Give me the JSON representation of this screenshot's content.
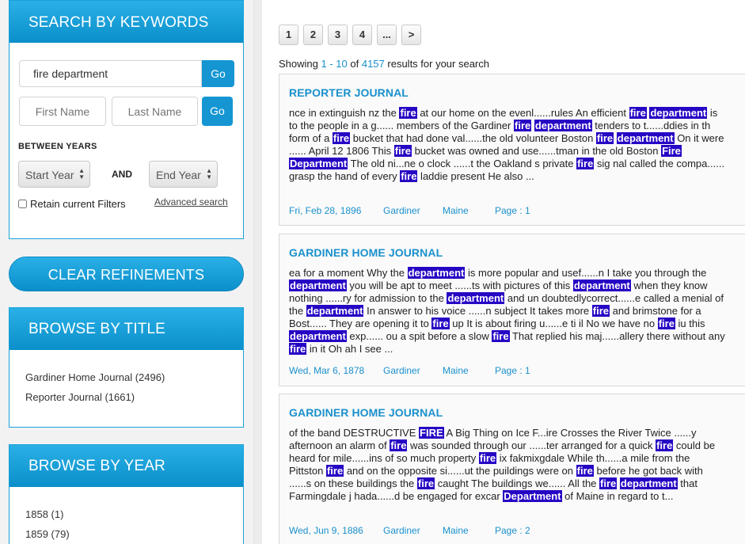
{
  "search_panel": {
    "title": "SEARCH BY KEYWORDS",
    "keyword_value": "fire department",
    "go_label": "Go",
    "first_name_placeholder": "First Name",
    "last_name_placeholder": "Last Name",
    "between_years_label": "BETWEEN YEARS",
    "start_year_label": "Start Year",
    "and_label": "AND",
    "end_year_label": "End Year",
    "retain_filters_label": "Retain current Filters",
    "advanced_search_label": "Advanced search"
  },
  "clear_refinements_label": "CLEAR REFINEMENTS",
  "browse_title": {
    "title": "BROWSE BY TITLE",
    "items": [
      "Gardiner Home Journal (2496)",
      "Reporter Journal (1661)"
    ]
  },
  "browse_year": {
    "title": "BROWSE BY YEAR",
    "items": [
      "1858 (1)",
      "1859 (79)"
    ]
  },
  "pager": {
    "pages": [
      "1",
      "2",
      "3",
      "4",
      "...",
      ">"
    ]
  },
  "showing": {
    "prefix": "Showing",
    "range": "1 - 10",
    "of": "of",
    "total": "4157",
    "suffix": "results for your search"
  },
  "results": [
    {
      "title": "REPORTER JOURNAL",
      "date": "Fri, Feb 28, 1896",
      "city": "Gardiner",
      "state": "Maine",
      "page": "Page : 1"
    },
    {
      "title": "GARDINER HOME JOURNAL",
      "date": "Wed, Mar 6, 1878",
      "city": "Gardiner",
      "state": "Maine",
      "page": "Page : 1"
    },
    {
      "title": "GARDINER HOME JOURNAL",
      "date": "Wed, Jun 9, 1886",
      "city": "Gardiner",
      "state": "Maine",
      "page": "Page : 2"
    }
  ],
  "snippets": [
    [
      {
        "t": "nce in extinguish nz the "
      },
      {
        "h": "fire"
      },
      {
        "t": " at our home on the evenl......rules An efficient "
      },
      {
        "h": "fire"
      },
      {
        "t": " "
      },
      {
        "h": "department"
      },
      {
        "t": " is to the people in a g...... members of the Gardiner "
      },
      {
        "h": "fire"
      },
      {
        "t": " "
      },
      {
        "h": "department"
      },
      {
        "t": " tenders to t......ddies in th form of a "
      },
      {
        "h": "fire"
      },
      {
        "t": " bucket that had done val......the old volunteer Boston "
      },
      {
        "h": "fire"
      },
      {
        "t": " "
      },
      {
        "h": "department"
      },
      {
        "t": " On it were ...... April 12 1806 This "
      },
      {
        "h": "fire"
      },
      {
        "t": " bucket was owned and use......tman in the old Boston "
      },
      {
        "h": "Fire"
      },
      {
        "t": " "
      },
      {
        "h": "Department"
      },
      {
        "t": " The old ni...ne o clock ......t the Oakland s private "
      },
      {
        "h": "fire"
      },
      {
        "t": " sig nal called the compa...... grasp the hand of every "
      },
      {
        "h": "fire"
      },
      {
        "t": " laddie present He also ..."
      }
    ],
    [
      {
        "t": "ea for a moment Why the "
      },
      {
        "h": "department"
      },
      {
        "t": " is more popular and usef......n I take you through the "
      },
      {
        "h": "department"
      },
      {
        "t": " you will be apt to meet ......ts with pictures of this "
      },
      {
        "h": "department"
      },
      {
        "t": " when they know nothing ......ry for admission to the "
      },
      {
        "h": "department"
      },
      {
        "t": " and un doubtedlycorrect......e called a menial of the "
      },
      {
        "h": "department"
      },
      {
        "t": " In answer to his voice ......n subject It takes more "
      },
      {
        "h": "fire"
      },
      {
        "t": " and brimstone for a Bost...... They are opening it to "
      },
      {
        "h": "fire"
      },
      {
        "t": " up It is about firing u......e ti il No we have no "
      },
      {
        "h": "fire"
      },
      {
        "t": " iu this "
      },
      {
        "h": "department"
      },
      {
        "t": " exp...... ou a spit before a slow "
      },
      {
        "h": "fire"
      },
      {
        "t": " That replied his maj......allery there without any "
      },
      {
        "h": "fire"
      },
      {
        "t": " in it Oh ah I see ..."
      }
    ],
    [
      {
        "t": "of the band DESTRUCTIVE "
      },
      {
        "h": "FIRE"
      },
      {
        "t": " A Big Thing on Ice F...ire Crosses the River Twice ......y afternoon an alarm of "
      },
      {
        "h": "fire"
      },
      {
        "t": " was sounded through our ......ter arranged for a quick "
      },
      {
        "h": "fire"
      },
      {
        "t": " could be heard for mile......ins of so much property "
      },
      {
        "h": "fire"
      },
      {
        "t": " ix fakmixgdale While th......a mile from the Pittston "
      },
      {
        "h": "fire"
      },
      {
        "t": " and on the opposite si......ut the puildings were on "
      },
      {
        "h": "fire"
      },
      {
        "t": " before he got back with ......s on these buildings the "
      },
      {
        "h": "fire"
      },
      {
        "t": " caught The buildings we...... All the "
      },
      {
        "h": "fire"
      },
      {
        "t": " "
      },
      {
        "h": "department"
      },
      {
        "t": " that Farmingdale j hada......d be engaged for excar "
      },
      {
        "h": "Department"
      },
      {
        "t": " of Maine in regard to t..."
      }
    ]
  ],
  "colors": {
    "accent": "#1596d3",
    "highlight_bg": "#2606c4",
    "link": "#1a90cc"
  }
}
